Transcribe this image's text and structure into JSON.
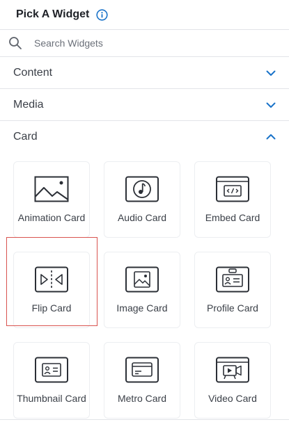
{
  "header": {
    "title": "Pick A Widget",
    "info_icon": "info-circle-icon"
  },
  "search": {
    "placeholder": "Search Widgets",
    "value": "",
    "icon": "search-icon"
  },
  "sections": [
    {
      "label": "Content",
      "expanded": false
    },
    {
      "label": "Media",
      "expanded": false
    },
    {
      "label": "Card",
      "expanded": true
    }
  ],
  "cards": [
    {
      "label": "Animation Card",
      "icon": "landscape-image-icon"
    },
    {
      "label": "Audio Card",
      "icon": "music-note-icon"
    },
    {
      "label": "Embed Card",
      "icon": "code-embed-icon"
    },
    {
      "label": "Flip Card",
      "icon": "flip-icon",
      "selected": true
    },
    {
      "label": "Image Card",
      "icon": "image-icon"
    },
    {
      "label": "Profile Card",
      "icon": "profile-card-icon"
    },
    {
      "label": "Thumbnail Card",
      "icon": "id-card-icon"
    },
    {
      "label": "Metro Card",
      "icon": "credit-card-icon"
    },
    {
      "label": "Video Card",
      "icon": "video-camera-icon"
    }
  ],
  "colors": {
    "accent": "#1a73c9",
    "selected_outline": "#d9534f",
    "icon_stroke": "#2b2f36"
  }
}
